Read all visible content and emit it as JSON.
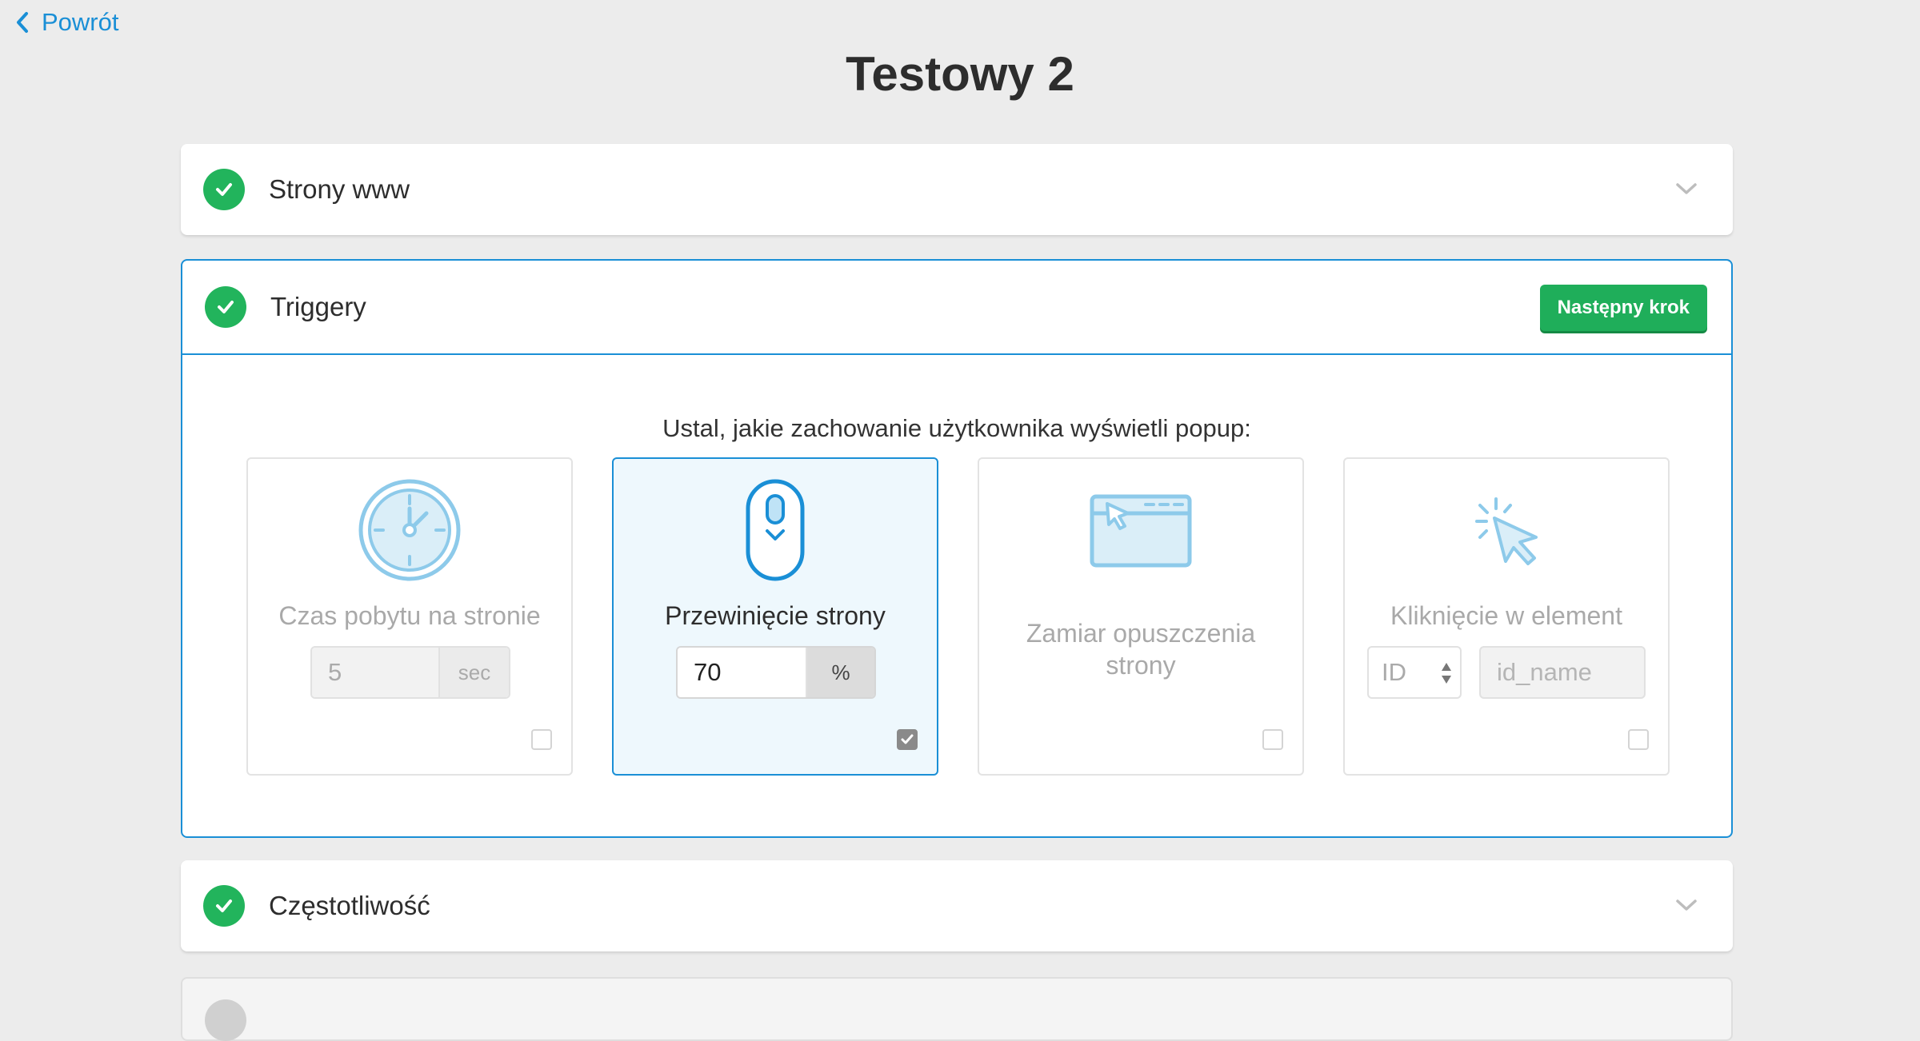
{
  "nav": {
    "back_label": "Powrót",
    "back_icon": "chevron-left-icon"
  },
  "page": {
    "title": "Testowy 2"
  },
  "colors": {
    "accent": "#1a8fd6",
    "success": "#22b45c",
    "background": "#ececec"
  },
  "sections": [
    {
      "title": "Strony www",
      "status": "complete",
      "expanded": false
    },
    {
      "title": "Triggery",
      "status": "complete",
      "expanded": true,
      "next_button_label": "Następny krok",
      "instruction": "Ustal, jakie zachowanie użytkownika wyświetli popup:",
      "triggers": [
        {
          "label": "Czas pobytu na stronie",
          "icon": "clock-icon",
          "value": "5",
          "unit": "sec",
          "selected": false,
          "checked": false
        },
        {
          "label": "Przewinięcie strony",
          "icon": "mouse-scroll-icon",
          "value": "70",
          "unit": "%",
          "selected": true,
          "checked": true
        },
        {
          "label": "Zamiar opuszczenia strony",
          "icon": "browser-exit-icon",
          "selected": false,
          "checked": false
        },
        {
          "label": "Kliknięcie w element",
          "icon": "click-cursor-icon",
          "select_value": "ID",
          "placeholder": "id_name",
          "selected": false,
          "checked": false
        }
      ]
    },
    {
      "title": "Częstotliwość",
      "status": "complete",
      "expanded": false
    }
  ]
}
